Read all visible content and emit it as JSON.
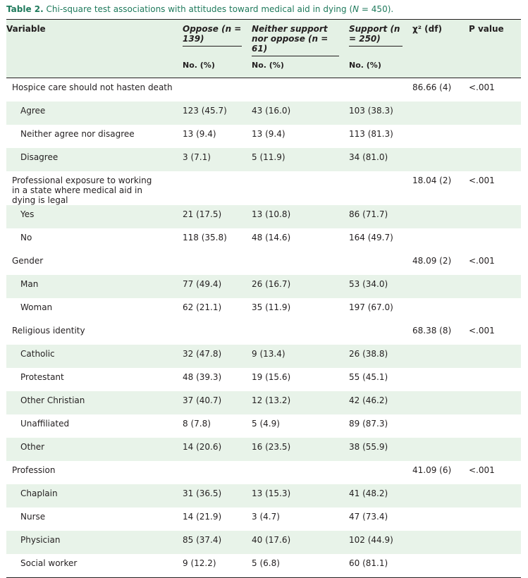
{
  "caption": {
    "label": "Table 2.",
    "text_before_n": "Chi-square test associations with attitudes toward medical aid in dying (",
    "n_symbol": "N",
    "text_after_n": " = 450)."
  },
  "header": {
    "variable": "Variable",
    "oppose": "Oppose (n = 139)",
    "neither": "Neither support nor oppose (n = 61)",
    "support": "Support (n = 250)",
    "chi": "χ² (df)",
    "p": "P value",
    "no_pct": "No. (%)"
  },
  "rows": [
    {
      "type": "group",
      "label": "Hospice care should not hasten death",
      "oppose": "",
      "neither": "",
      "support": "",
      "chi": "86.66 (4)",
      "p": "<.001"
    },
    {
      "type": "sub",
      "label": "Agree",
      "oppose": "123 (45.7)",
      "neither": "43 (16.0)",
      "support": "103 (38.3)",
      "chi": "",
      "p": ""
    },
    {
      "type": "sub",
      "label": "Neither agree nor disagree",
      "oppose": "13 (9.4)",
      "neither": "13 (9.4)",
      "support": "113 (81.3)",
      "chi": "",
      "p": ""
    },
    {
      "type": "sub",
      "label": "Disagree",
      "oppose": "3 (7.1)",
      "neither": "5 (11.9)",
      "support": "34 (81.0)",
      "chi": "",
      "p": ""
    },
    {
      "type": "group",
      "label": "Professional exposure to working in a state where medical aid in dying is legal",
      "oppose": "",
      "neither": "",
      "support": "",
      "chi": "18.04 (2)",
      "p": "<.001"
    },
    {
      "type": "sub",
      "label": "Yes",
      "oppose": "21 (17.5)",
      "neither": "13 (10.8)",
      "support": "86 (71.7)",
      "chi": "",
      "p": ""
    },
    {
      "type": "sub",
      "label": "No",
      "oppose": "118 (35.8)",
      "neither": "48 (14.6)",
      "support": "164 (49.7)",
      "chi": "",
      "p": ""
    },
    {
      "type": "group",
      "label": "Gender",
      "oppose": "",
      "neither": "",
      "support": "",
      "chi": "48.09 (2)",
      "p": "<.001"
    },
    {
      "type": "sub",
      "label": "Man",
      "oppose": "77 (49.4)",
      "neither": "26 (16.7)",
      "support": "53 (34.0)",
      "chi": "",
      "p": ""
    },
    {
      "type": "sub",
      "label": "Woman",
      "oppose": "62 (21.1)",
      "neither": "35 (11.9)",
      "support": "197 (67.0)",
      "chi": "",
      "p": ""
    },
    {
      "type": "group",
      "label": "Religious identity",
      "oppose": "",
      "neither": "",
      "support": "",
      "chi": "68.38 (8)",
      "p": "<.001"
    },
    {
      "type": "sub",
      "label": "Catholic",
      "oppose": "32 (47.8)",
      "neither": "9 (13.4)",
      "support": "26 (38.8)",
      "chi": "",
      "p": ""
    },
    {
      "type": "sub",
      "label": "Protestant",
      "oppose": "48 (39.3)",
      "neither": "19 (15.6)",
      "support": "55 (45.1)",
      "chi": "",
      "p": ""
    },
    {
      "type": "sub",
      "label": "Other Christian",
      "oppose": "37 (40.7)",
      "neither": "12 (13.2)",
      "support": "42 (46.2)",
      "chi": "",
      "p": ""
    },
    {
      "type": "sub",
      "label": "Unaffiliated",
      "oppose": "8 (7.8)",
      "neither": "5 (4.9)",
      "support": "89 (87.3)",
      "chi": "",
      "p": ""
    },
    {
      "type": "sub",
      "label": "Other",
      "oppose": "14 (20.6)",
      "neither": "16 (23.5)",
      "support": "38 (55.9)",
      "chi": "",
      "p": ""
    },
    {
      "type": "group",
      "label": "Profession",
      "oppose": "",
      "neither": "",
      "support": "",
      "chi": "41.09 (6)",
      "p": "<.001"
    },
    {
      "type": "sub",
      "label": "Chaplain",
      "oppose": "31 (36.5)",
      "neither": "13 (15.3)",
      "support": "41 (48.2)",
      "chi": "",
      "p": ""
    },
    {
      "type": "sub",
      "label": "Nurse",
      "oppose": "14 (21.9)",
      "neither": "3 (4.7)",
      "support": "47 (73.4)",
      "chi": "",
      "p": ""
    },
    {
      "type": "sub",
      "label": "Physician",
      "oppose": "85 (37.4)",
      "neither": "40 (17.6)",
      "support": "102 (44.9)",
      "chi": "",
      "p": ""
    },
    {
      "type": "sub",
      "label": "Social worker",
      "oppose": "9 (12.2)",
      "neither": "5 (6.8)",
      "support": "60 (81.1)",
      "chi": "",
      "p": ""
    }
  ]
}
